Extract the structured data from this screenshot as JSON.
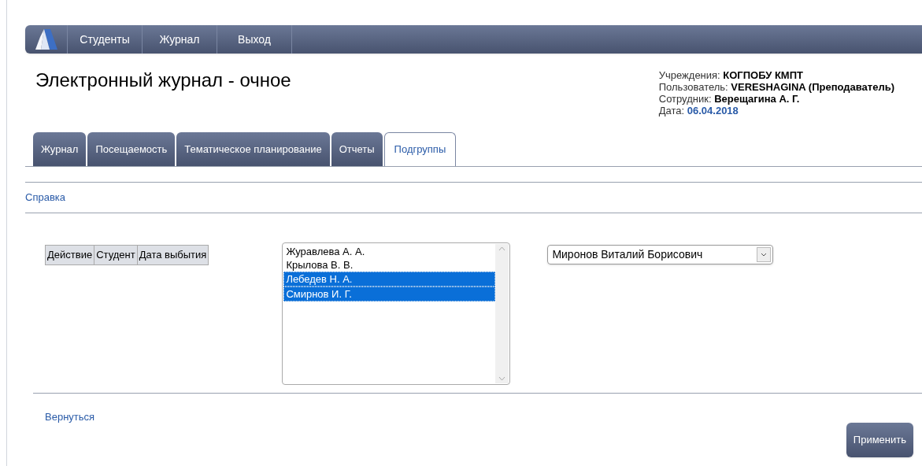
{
  "nav": {
    "items": [
      {
        "label": "Студенты"
      },
      {
        "label": "Журнал"
      },
      {
        "label": "Выход"
      }
    ]
  },
  "title": "Электронный журнал - очное",
  "info": [
    {
      "label": "Учреждения: ",
      "value": "КОГПОБУ КМПТ",
      "kind": "bold"
    },
    {
      "label": "Пользователь: ",
      "value": "VERESHAGINA (Преподаватель)",
      "kind": "bold"
    },
    {
      "label": "Сотрудник: ",
      "value": "Верещагина А. Г.",
      "kind": "bold"
    },
    {
      "label": "Дата: ",
      "value": "06.04.2018",
      "kind": "date"
    }
  ],
  "tabs": [
    {
      "label": "Журнал",
      "selected": false
    },
    {
      "label": "Посещаемость",
      "selected": false
    },
    {
      "label": "Тематическое планирование",
      "selected": false
    },
    {
      "label": "Отчеты",
      "selected": false
    },
    {
      "label": "Подгруппы",
      "selected": true
    }
  ],
  "help_link": "Справка",
  "table": {
    "columns": [
      "Действие",
      "Студент",
      "Дата выбытия"
    ]
  },
  "students": [
    {
      "label": "Журавлева А. А.",
      "selected": false
    },
    {
      "label": "Крылова В. В.",
      "selected": false
    },
    {
      "label": "Лебедев Н. А.",
      "selected": true
    },
    {
      "label": "Смирнов И. Г.",
      "selected": true
    }
  ],
  "teacher_select": {
    "value": "Миронов Виталий Борисович"
  },
  "back_link": "Вернуться",
  "apply_button": "Применить"
}
